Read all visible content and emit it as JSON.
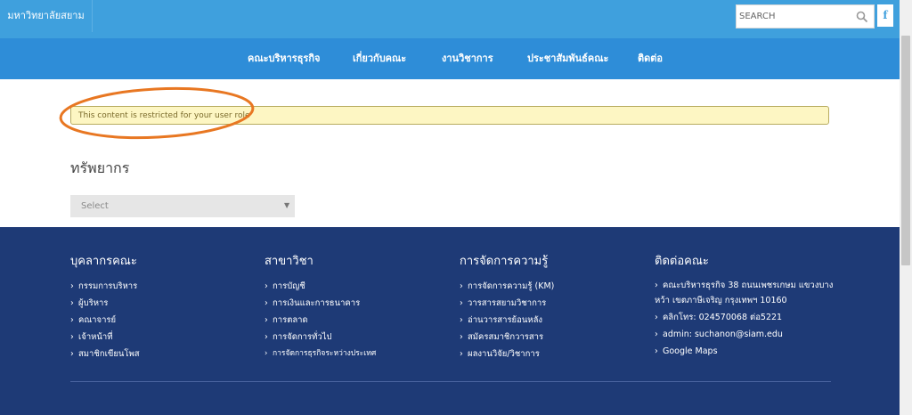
{
  "header": {
    "site_name": "มหาวิทยาลัยสยาม",
    "search": {
      "placeholder": "SEARCH",
      "value": ""
    },
    "social": {
      "facebook_label": "f"
    }
  },
  "nav": {
    "items": [
      {
        "label": "คณะบริหารธุรกิจ"
      },
      {
        "label": "เกี่ยวกับคณะ"
      },
      {
        "label": "งานวิชาการ"
      },
      {
        "label": "ประชาสัมพันธ์คณะ"
      },
      {
        "label": "ติดต่อ"
      }
    ]
  },
  "main": {
    "notice": "This content is restricted for your user role",
    "section_title": "ทรัพยากร",
    "select": {
      "value": "Select"
    }
  },
  "footer": {
    "columns": [
      {
        "title": "บุคลากรคณะ",
        "items": [
          "กรรมการบริหาร",
          "ผู้บริหาร",
          "คณาจารย์",
          "เจ้าหน้าที่",
          "สมาชิกเขียนโพส"
        ]
      },
      {
        "title": "สาขาวิชา",
        "items": [
          "การบัญชี",
          "การเงินและการธนาคาร",
          "การตลาด",
          "การจัดการทั่วไป",
          "การจัดการธุรกิจระหว่างประเทศ"
        ]
      },
      {
        "title": "การจัดการความรู้",
        "items": [
          "การจัดการความรู้ (KM)",
          "วารสารสยามวิชาการ",
          "อ่านวารสารย้อนหลัง",
          "สมัครสมาชิกวารสาร",
          "ผลงานวิจัย/วิชาการ"
        ]
      }
    ],
    "contact": {
      "title": "ติดต่อคณะ",
      "address": "คณะบริหารธุรกิจ 38 ถนนเพชรเกษม แขวงบางหว้า เขตภาษีเจริญ กรุงเทพฯ 10160",
      "phone": "คลิกโทร: 024570068 ต่อ5221",
      "email": "admin: suchanon@siam.edu",
      "maps": "Google Maps"
    }
  },
  "colors": {
    "topbar": "#3fa0dd",
    "navbar": "#2e8dd8",
    "footer": "#1e3a76",
    "notice_bg": "#fdf6c3",
    "annotation": "#e87722"
  }
}
